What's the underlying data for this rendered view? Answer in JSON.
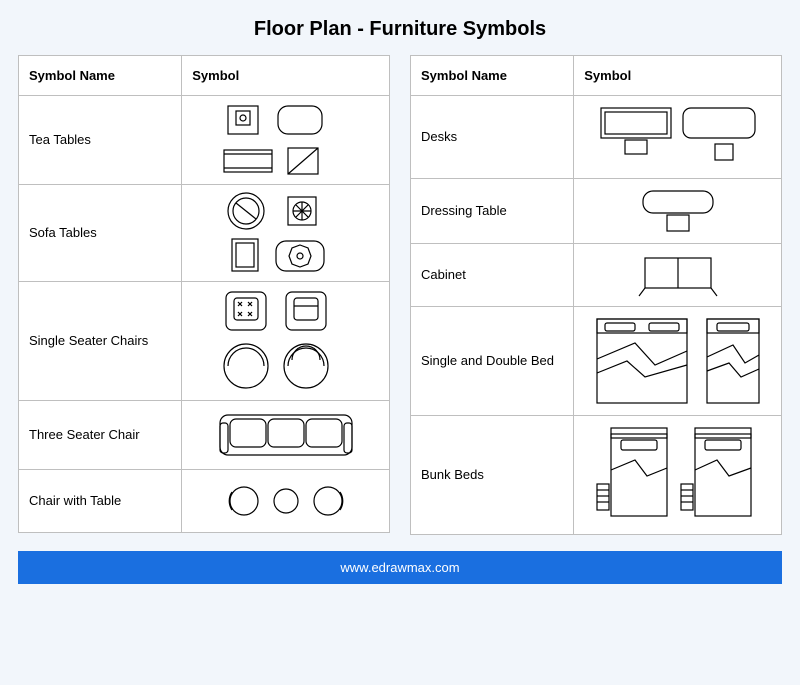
{
  "title": "Floor Plan - Furniture Symbols",
  "headers": {
    "name": "Symbol Name",
    "symbol": "Symbol"
  },
  "left_rows": [
    {
      "name": "Tea Tables"
    },
    {
      "name": "Sofa Tables"
    },
    {
      "name": "Single Seater Chairs"
    },
    {
      "name": "Three Seater Chair"
    },
    {
      "name": "Chair with Table"
    }
  ],
  "right_rows": [
    {
      "name": "Desks"
    },
    {
      "name": "Dressing Table"
    },
    {
      "name": "Cabinet"
    },
    {
      "name": "Single and Double Bed"
    },
    {
      "name": "Bunk Beds"
    }
  ],
  "footer": "www.edrawmax.com"
}
